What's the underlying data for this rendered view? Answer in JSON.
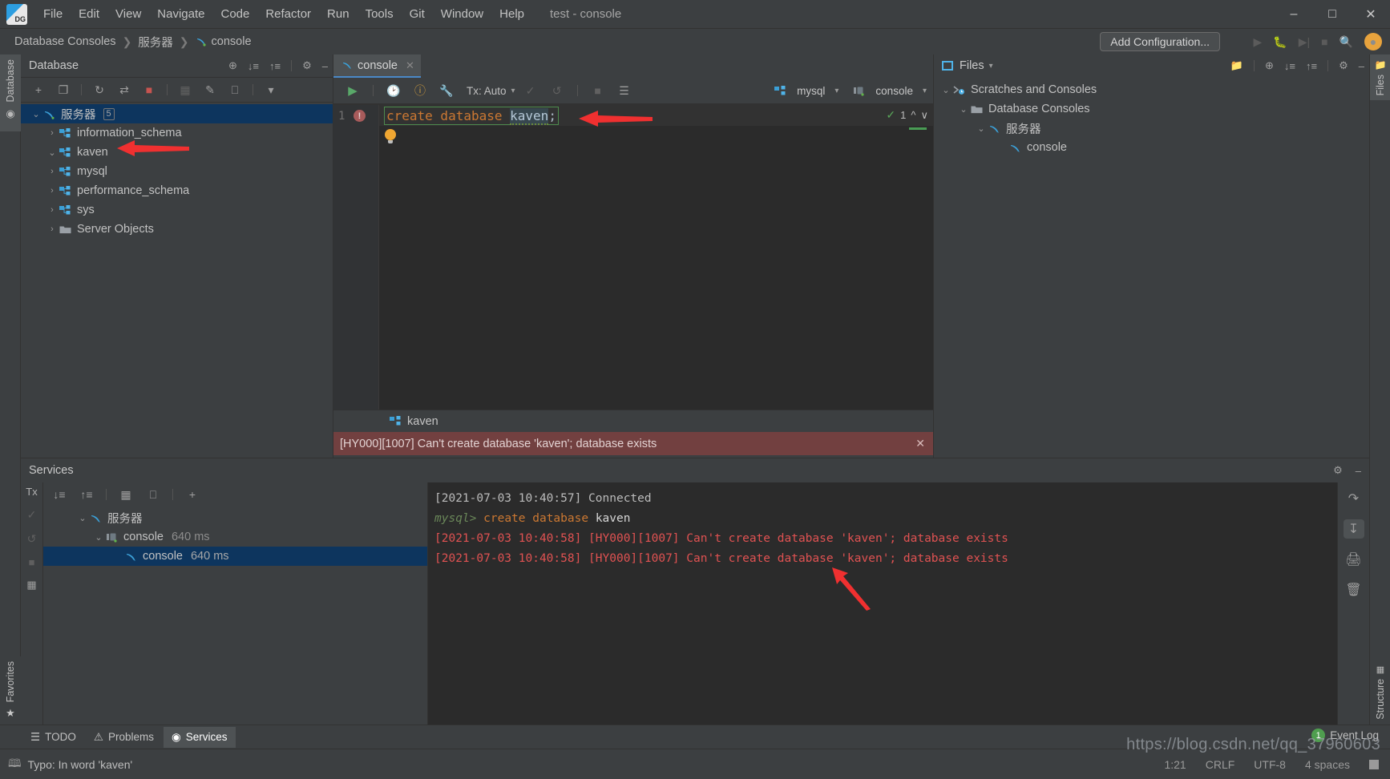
{
  "window": {
    "title": "test - console",
    "minimize": "–",
    "maximize": "□",
    "close": "✕"
  },
  "menubar": {
    "items": [
      "File",
      "Edit",
      "View",
      "Navigate",
      "Code",
      "Refactor",
      "Run",
      "Tools",
      "Git",
      "Window",
      "Help"
    ]
  },
  "navbar": {
    "breadcrumb": [
      "Database Consoles",
      "服务器",
      "console"
    ],
    "add_configuration": "Add Configuration...",
    "separator": "❯"
  },
  "left_rail": {
    "database_tab": "Database",
    "favorites_tab": "Favorites"
  },
  "right_rail": {
    "files_tab": "Files",
    "structure_tab": "Structure"
  },
  "database_panel": {
    "title": "Database",
    "tree": [
      {
        "label": "服务器",
        "badge": "5",
        "arrow": "⌄",
        "icon": "mysql-dolphin-icon",
        "depth": 0,
        "selected": true
      },
      {
        "label": "information_schema",
        "badge": "",
        "arrow": "›",
        "icon": "schema-icon",
        "depth": 1,
        "selected": false
      },
      {
        "label": "kaven",
        "badge": "",
        "arrow": "⌄",
        "icon": "schema-icon",
        "depth": 1,
        "selected": false
      },
      {
        "label": "mysql",
        "badge": "",
        "arrow": "›",
        "icon": "schema-icon",
        "depth": 1,
        "selected": false
      },
      {
        "label": "performance_schema",
        "badge": "",
        "arrow": "›",
        "icon": "schema-icon",
        "depth": 1,
        "selected": false
      },
      {
        "label": "sys",
        "badge": "",
        "arrow": "›",
        "icon": "schema-icon",
        "depth": 1,
        "selected": false
      },
      {
        "label": "Server Objects",
        "badge": "",
        "arrow": "›",
        "icon": "folder-icon",
        "depth": 1,
        "selected": false
      }
    ]
  },
  "editor": {
    "tab_label": "console",
    "tab_close": "✕",
    "tx_label": "Tx: Auto",
    "schema_selector": "mysql",
    "session_selector": "console",
    "line_number": "1",
    "code": {
      "keyword": "create database",
      "identifier": "kaven",
      "terminator": ";"
    },
    "inspection_count": "1",
    "result_tab": "kaven",
    "error_message": "[HY000][1007] Can't create database 'kaven'; database exists",
    "error_close": "✕"
  },
  "files_panel": {
    "title": "Files",
    "tree": [
      {
        "label": "Scratches and Consoles",
        "arrow": "⌄",
        "icon": "scratches-icon",
        "depth": 0
      },
      {
        "label": "Database Consoles",
        "arrow": "⌄",
        "icon": "folder-icon",
        "depth": 1
      },
      {
        "label": "服务器",
        "arrow": "⌄",
        "icon": "mysql-dolphin-icon",
        "depth": 2
      },
      {
        "label": "console",
        "arrow": "",
        "icon": "mysql-dolphin-icon",
        "depth": 3
      }
    ]
  },
  "services": {
    "title": "Services",
    "tx_label": "Tx",
    "tree": [
      {
        "label": "服务器",
        "time": "",
        "arrow": "⌄",
        "icon": "mysql-dolphin-icon",
        "depth": 0,
        "selected": false
      },
      {
        "label": "console",
        "time": "640 ms",
        "arrow": "⌄",
        "icon": "session-icon",
        "depth": 1,
        "selected": false
      },
      {
        "label": "console",
        "time": "640 ms",
        "arrow": "",
        "icon": "mysql-dolphin-icon",
        "depth": 2,
        "selected": true
      }
    ],
    "console_lines": [
      {
        "type": "info",
        "text": "[2021-07-03 10:40:57] Connected"
      },
      {
        "type": "query",
        "prompt": "mysql>",
        "sql": "create database",
        "object": "kaven"
      },
      {
        "type": "error",
        "text": "[2021-07-03 10:40:58] [HY000][1007] Can't create database 'kaven'; database exists"
      },
      {
        "type": "error",
        "text": "[2021-07-03 10:40:58] [HY000][1007] Can't create database 'kaven'; database exists"
      }
    ]
  },
  "bottom_tabs": [
    {
      "label": "TODO",
      "icon": "list-icon",
      "active": false
    },
    {
      "label": "Problems",
      "icon": "error-icon",
      "active": false
    },
    {
      "label": "Services",
      "icon": "play-circle-icon",
      "active": true
    }
  ],
  "status": {
    "message": "Typo: In word 'kaven'",
    "caret": "1:21",
    "line_sep": "CRLF",
    "encoding": "UTF-8",
    "indent": "4 spaces",
    "event_log": "Event Log",
    "event_count": "1"
  },
  "watermark": "https://blog.csdn.net/qq_37960603",
  "colors": {
    "bg": "#3c3f41",
    "editor_bg": "#2b2b2b",
    "accent_blue": "#4a88c7",
    "selection": "#0d355e",
    "error_bar": "#724040",
    "error_text": "#e05252",
    "keyword": "#cc7832",
    "green": "#6a8759",
    "annotation_red": "#f03030"
  }
}
